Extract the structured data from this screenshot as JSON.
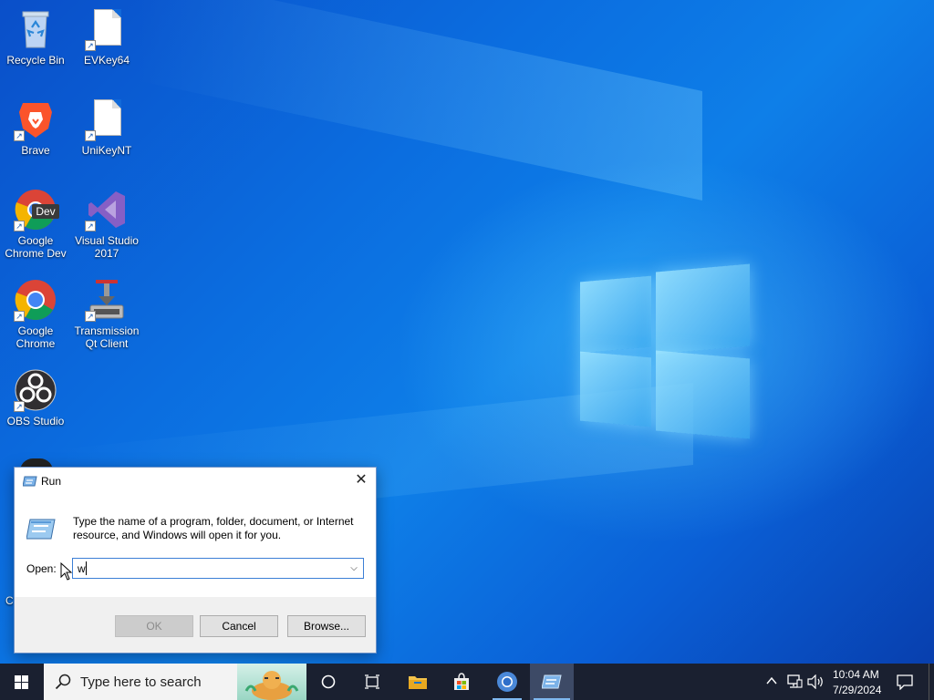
{
  "desktop": {
    "icons": [
      {
        "label": "Recycle Bin"
      },
      {
        "label": "EVKey64"
      },
      {
        "label": "Brave"
      },
      {
        "label": "UniKeyNT"
      },
      {
        "label": "Google\nChrome Dev",
        "line1": "Google",
        "line2": "Chrome Dev",
        "badge": "Dev"
      },
      {
        "label": "Visual Studio 2017",
        "line1": "Visual Studio",
        "line2": "2017"
      },
      {
        "label": "Google Chrome",
        "line1": "Google",
        "line2": "Chrome"
      },
      {
        "label": "Transmission Qt Client",
        "line1": "Transmission",
        "line2": "Qt Client"
      },
      {
        "label": "OBS Studio"
      }
    ],
    "partial_label": "C"
  },
  "run_dialog": {
    "title": "Run",
    "description": "Type the name of a program, folder, document, or Internet resource, and Windows will open it for you.",
    "open_label": "Open:",
    "input_value": "w",
    "ok_label": "OK",
    "cancel_label": "Cancel",
    "browse_label": "Browse..."
  },
  "taskbar": {
    "search_placeholder": "Type here to search",
    "time": "10:04 AM",
    "date": "7/29/2024"
  },
  "colors": {
    "accent": "#0078d7",
    "taskbar": "#1a2030"
  }
}
